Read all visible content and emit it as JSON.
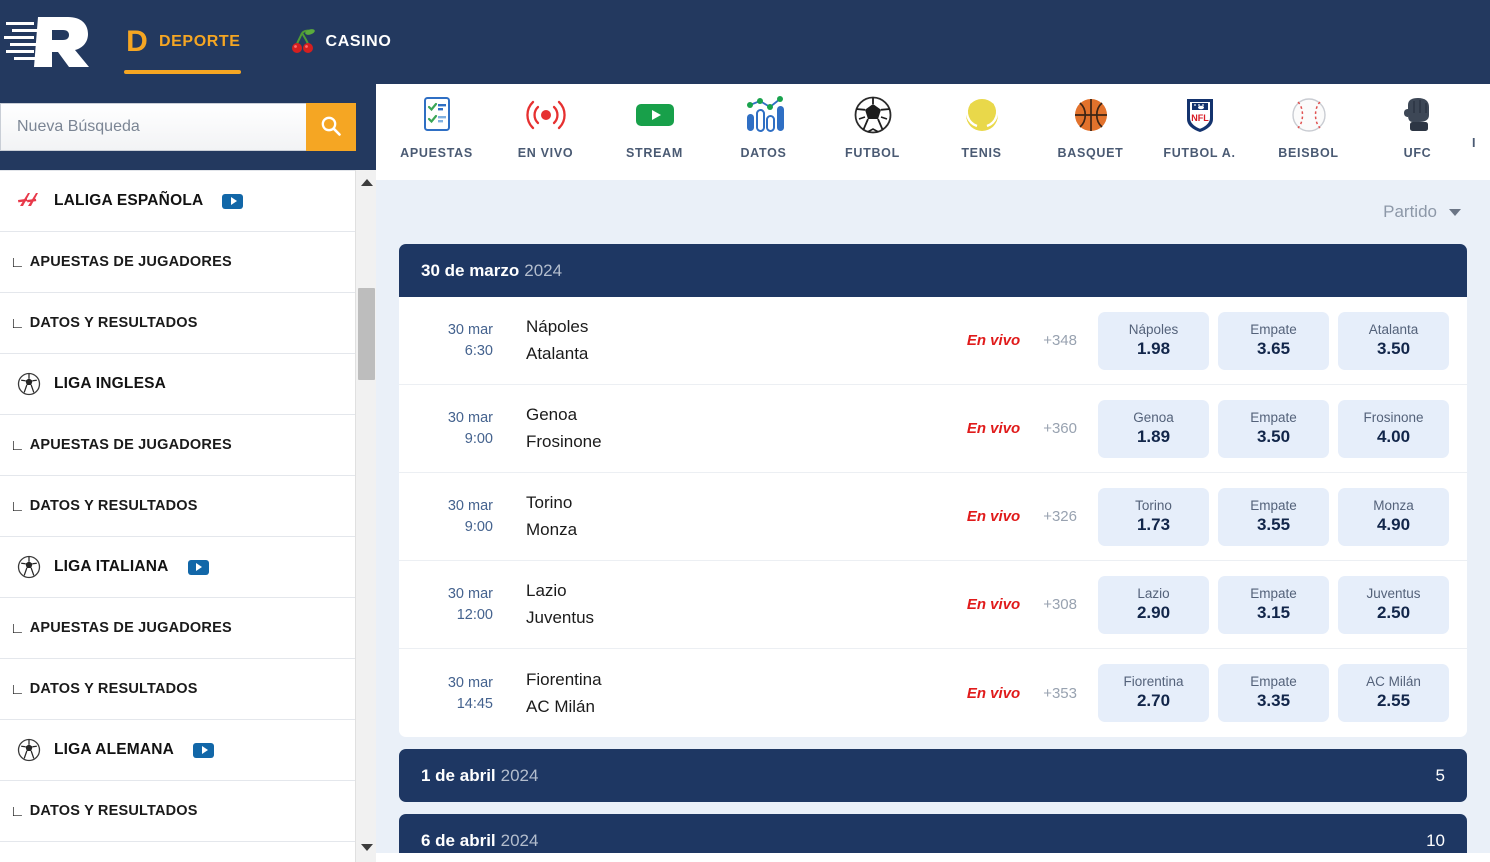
{
  "header": {
    "logo_name": "brand-logo-r",
    "tabs": [
      {
        "label": "DEPORTE",
        "icon": "letter-d-icon",
        "active": true
      },
      {
        "label": "CASINO",
        "icon": "cherries-icon",
        "active": false
      }
    ]
  },
  "sidebar": {
    "search": {
      "placeholder": "Nueva Búsqueda",
      "value": "",
      "button_icon": "search-icon"
    },
    "items": [
      {
        "label": "LALIGA ESPAÑOLA",
        "icon": "laliga-logo-icon",
        "type": "league",
        "video": true
      },
      {
        "label": "APUESTAS DE JUGADORES",
        "type": "sub",
        "video": false
      },
      {
        "label": "DATOS Y RESULTADOS",
        "type": "sub",
        "video": false
      },
      {
        "label": "LIGA INGLESA",
        "icon": "soccer-ball-icon",
        "type": "league",
        "video": false
      },
      {
        "label": "APUESTAS DE JUGADORES",
        "type": "sub",
        "video": false
      },
      {
        "label": "DATOS Y RESULTADOS",
        "type": "sub",
        "video": false
      },
      {
        "label": "LIGA ITALIANA",
        "icon": "soccer-ball-icon",
        "type": "league",
        "video": true
      },
      {
        "label": "APUESTAS DE JUGADORES",
        "type": "sub",
        "video": false
      },
      {
        "label": "DATOS Y RESULTADOS",
        "type": "sub",
        "video": false
      },
      {
        "label": "LIGA ALEMANA",
        "icon": "soccer-ball-icon",
        "type": "league",
        "video": true
      },
      {
        "label": "DATOS Y RESULTADOS",
        "type": "sub",
        "video": false
      }
    ],
    "tree_mark": "∟"
  },
  "sport_nav": {
    "items": [
      {
        "label": "APUESTAS",
        "icon": "betslip-icon",
        "active": false
      },
      {
        "label": "EN VIVO",
        "icon": "live-broadcast-icon",
        "active": false
      },
      {
        "label": "STREAM",
        "icon": "play-video-icon",
        "active": false
      },
      {
        "label": "DATOS",
        "icon": "stats-chart-icon",
        "active": true
      },
      {
        "label": "FUTBOL",
        "icon": "soccer-ball-icon",
        "active": false
      },
      {
        "label": "TENIS",
        "icon": "tennis-ball-icon",
        "active": false
      },
      {
        "label": "BASQUET",
        "icon": "basketball-icon",
        "active": false
      },
      {
        "label": "FUTBOL A.",
        "icon": "nfl-shield-icon",
        "active": false
      },
      {
        "label": "BEISBOL",
        "icon": "baseball-icon",
        "active": false
      },
      {
        "label": "UFC",
        "icon": "boxing-glove-icon",
        "active": false
      }
    ],
    "cut_off_label": "I"
  },
  "filter": {
    "label": "Partido",
    "caret_icon": "chevron-down-icon"
  },
  "date_groups": [
    {
      "day": "30 de marzo",
      "year": "2024",
      "count": "",
      "expanded": true,
      "matches": [
        {
          "date": "30 mar",
          "time": "6:30",
          "home": "Nápoles",
          "away": "Atalanta",
          "live": "En vivo",
          "more": "+348",
          "odds": [
            {
              "name": "Nápoles",
              "value": "1.98"
            },
            {
              "name": "Empate",
              "value": "3.65"
            },
            {
              "name": "Atalanta",
              "value": "3.50"
            }
          ]
        },
        {
          "date": "30 mar",
          "time": "9:00",
          "home": "Genoa",
          "away": "Frosinone",
          "live": "En vivo",
          "more": "+360",
          "odds": [
            {
              "name": "Genoa",
              "value": "1.89"
            },
            {
              "name": "Empate",
              "value": "3.50"
            },
            {
              "name": "Frosinone",
              "value": "4.00"
            }
          ]
        },
        {
          "date": "30 mar",
          "time": "9:00",
          "home": "Torino",
          "away": "Monza",
          "live": "En vivo",
          "more": "+326",
          "odds": [
            {
              "name": "Torino",
              "value": "1.73"
            },
            {
              "name": "Empate",
              "value": "3.55"
            },
            {
              "name": "Monza",
              "value": "4.90"
            }
          ]
        },
        {
          "date": "30 mar",
          "time": "12:00",
          "home": "Lazio",
          "away": "Juventus",
          "live": "En vivo",
          "more": "+308",
          "odds": [
            {
              "name": "Lazio",
              "value": "2.90"
            },
            {
              "name": "Empate",
              "value": "3.15"
            },
            {
              "name": "Juventus",
              "value": "2.50"
            }
          ]
        },
        {
          "date": "30 mar",
          "time": "14:45",
          "home": "Fiorentina",
          "away": "AC Milán",
          "live": "En vivo",
          "more": "+353",
          "odds": [
            {
              "name": "Fiorentina",
              "value": "2.70"
            },
            {
              "name": "Empate",
              "value": "3.35"
            },
            {
              "name": "AC Milán",
              "value": "2.55"
            }
          ]
        }
      ]
    },
    {
      "day": "1 de abril",
      "year": "2024",
      "count": "5",
      "expanded": false,
      "matches": []
    },
    {
      "day": "6 de abril",
      "year": "2024",
      "count": "10",
      "expanded": false,
      "matches": []
    }
  ],
  "colors": {
    "header_navy": "#23395f",
    "date_navy": "#1e3763",
    "accent_orange": "#f5a623",
    "content_bg": "#eaf0f8",
    "odd_bg": "#e6eefa",
    "live_red": "#e01b1b"
  }
}
